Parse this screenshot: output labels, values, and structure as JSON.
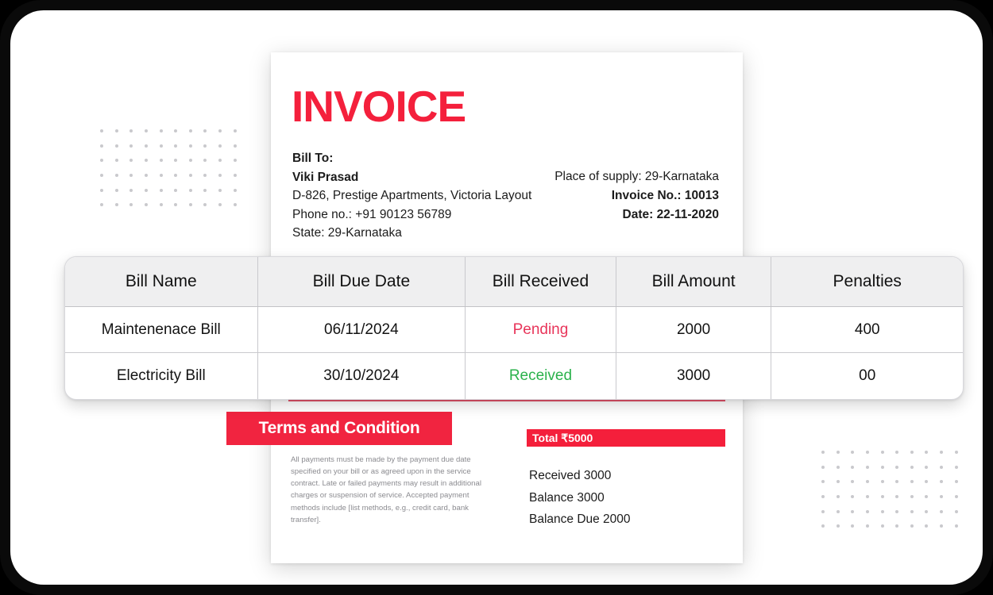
{
  "invoice": {
    "title": "INVOICE",
    "bill_to_label": "Bill To:",
    "bill_to_name": "Viki Prasad",
    "bill_to_address": "D-826, Prestige Apartments, Victoria Layout",
    "bill_to_phone": "Phone no.: +91 90123 56789",
    "bill_to_state": "State: 29-Karnataka",
    "place_of_supply": "Place of supply: 29-Karnataka",
    "invoice_number": "Invoice No.: 10013",
    "invoice_date": "Date: 22-11-2020"
  },
  "table": {
    "headers": [
      "Bill Name",
      "Bill Due Date",
      "Bill Received",
      "Bill Amount",
      "Penalties"
    ],
    "rows": [
      {
        "bill_name": "Maintenenace Bill",
        "due_date": "06/11/2024",
        "received": "Pending",
        "received_status": "pending",
        "amount": "2000",
        "penalties": "400"
      },
      {
        "bill_name": "Electricity Bill",
        "due_date": "30/10/2024",
        "received": "Received",
        "received_status": "received",
        "amount": "3000",
        "penalties": "00"
      }
    ]
  },
  "terms": {
    "heading": "Terms and Condition",
    "body": "All payments must be made by the payment due date specified on your bill or as agreed upon in the service contract. Late or failed payments may result in additional charges or suspension of service. Accepted payment methods include [list methods, e.g., credit card, bank transfer]."
  },
  "totals": {
    "total_label": "Total ₹5000",
    "received": "Received 3000",
    "balance": "Balance 3000",
    "balance_due": "Balance Due 2000"
  },
  "colors": {
    "accent_red": "#F4203C",
    "banner_red": "#F12440",
    "status_pending": "#E8355A",
    "status_received": "#2BB24C",
    "dot_gray": "#c9c9cd"
  }
}
